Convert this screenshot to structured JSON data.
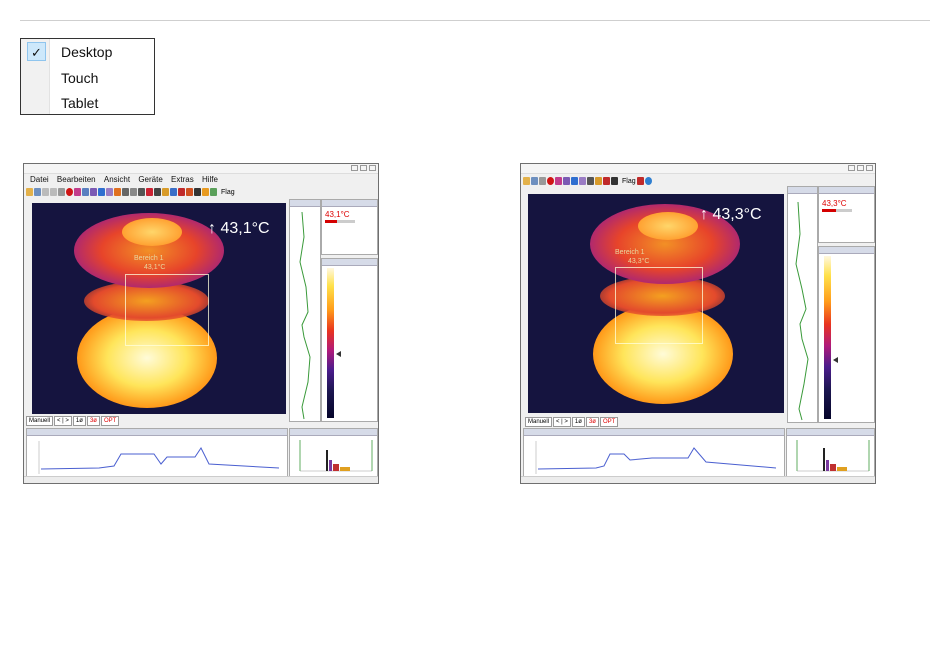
{
  "menu": {
    "items": [
      {
        "label": "Desktop",
        "checked": true
      },
      {
        "label": "Touch",
        "checked": false
      },
      {
        "label": "Tablet",
        "checked": false
      }
    ],
    "check_glyph": "✓"
  },
  "app": {
    "menubar": [
      "Datei",
      "Bearbeiten",
      "Ansicht",
      "Geräte",
      "Extras",
      "Hilfe"
    ],
    "toolbar_flag": "Flag",
    "buttons": [
      "Manuell",
      "< | >",
      "1ø",
      "3ø",
      "OPT"
    ]
  },
  "screens": [
    {
      "temperature": "↑ 43,1°C",
      "area_label": "Bereich 1",
      "area_temp": "43,1°C"
    },
    {
      "temperature": "↑ 43,3°C",
      "area_label": "Bereich 1",
      "area_temp": "43,3°C"
    }
  ],
  "colors": {
    "accent_red": "#d40000",
    "thermal_bg": "#15143f"
  }
}
